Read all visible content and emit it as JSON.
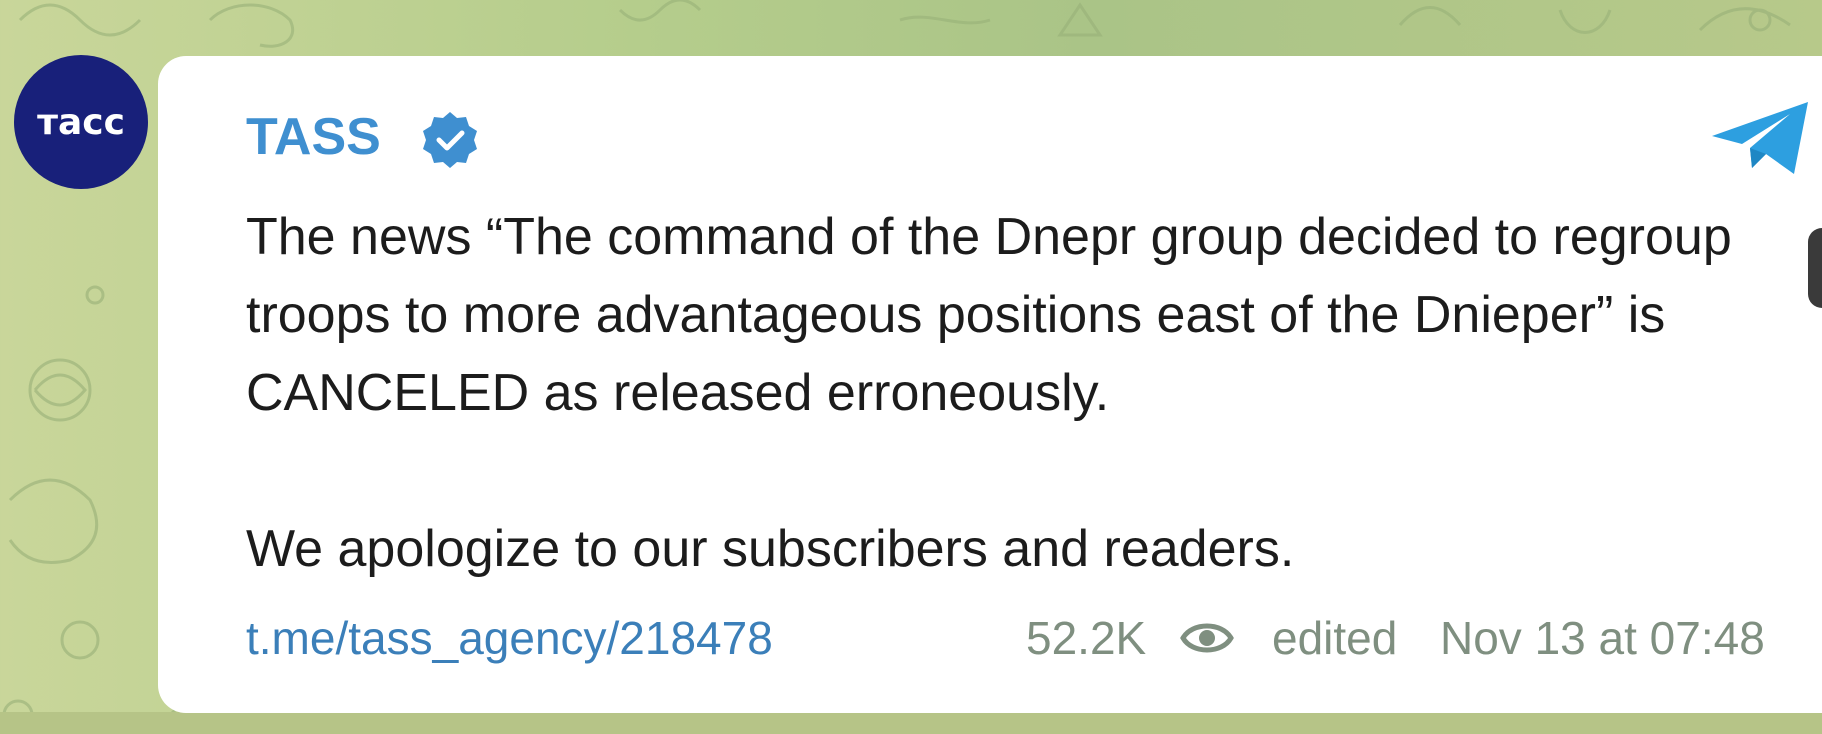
{
  "channel": {
    "avatar_text": "тасс",
    "name": "TASS",
    "verified": true
  },
  "message": {
    "paragraph1": "The news “The command of the Dnepr group decided to regroup troops to more advantageous positions east of the Dnieper” is CANCELED as released erroneously.",
    "paragraph2": "We apologize to our subscribers and readers."
  },
  "footer": {
    "link": "t.me/tass_agency/218478",
    "views": "52.2K",
    "edited_label": "edited",
    "timestamp": "Nov 13 at 07:48"
  },
  "icons": {
    "verified": "verified-badge-icon",
    "telegram": "telegram-logo-icon",
    "views": "eye-icon"
  },
  "colors": {
    "accent": "#3f8fd0",
    "link": "#3b7fb9",
    "muted": "#7f8f80",
    "avatar_bg": "#18207a",
    "background": "#b5cd8c"
  }
}
